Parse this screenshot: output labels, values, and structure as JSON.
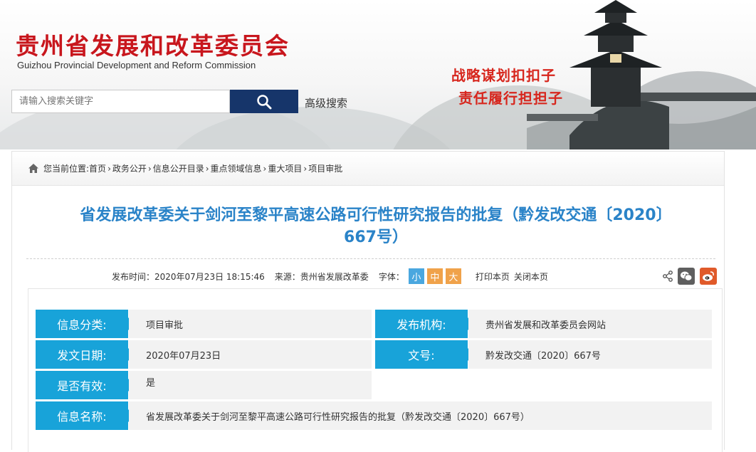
{
  "header": {
    "title": "贵州省发展和改革委员会",
    "subtitle": "Guizhou Provincial Development and Reform Commission",
    "slogan_line1": "战略谋划扣扣子",
    "slogan_line2": "责任履行担担子"
  },
  "search": {
    "placeholder": "请输入搜索关键字",
    "advanced_label": "高级搜索"
  },
  "breadcrumb": {
    "prefix": "您当前位置:",
    "items": [
      "首页",
      "政务公开",
      "信息公开目录",
      "重点领域信息",
      "重大项目",
      "项目审批"
    ],
    "separator": "›"
  },
  "article": {
    "title_line1": "省发展改革委关于剑河至黎平高速公路可行性研究报告的批复（黔发改交通〔2020〕",
    "title_line2": "667号）"
  },
  "meta": {
    "publish_time": "发布时间：2020年07月23日 18:15:46",
    "source": "来源：贵州省发展改革委",
    "font_label": "字体：",
    "font_small": "小",
    "font_mid": "中",
    "font_big": "大",
    "print": "打印本页",
    "close": "关闭本页"
  },
  "info": {
    "category_label": "信息分类:",
    "category_value": "项目审批",
    "publisher_label": "发布机构:",
    "publisher_value": "贵州省发展和改革委员会网站",
    "date_label": "发文日期:",
    "date_value": "2020年07月23日",
    "docno_label": "文号:",
    "docno_value": "黔发改交通〔2020〕667号",
    "valid_label": "是否有效:",
    "valid_value": "是",
    "name_label": "信息名称:",
    "name_value": "省发展改革委关于剑河至黎平高速公路可行性研究报告的批复（黔发改交通〔2020〕667号）"
  },
  "colors": {
    "title_red": "#c8161d",
    "accent_blue": "#18a3d9",
    "article_title_blue": "#2a83c8",
    "search_button": "#16356a"
  },
  "icons": [
    "search-icon",
    "home-icon",
    "share-icon",
    "wechat-icon",
    "weibo-icon"
  ]
}
